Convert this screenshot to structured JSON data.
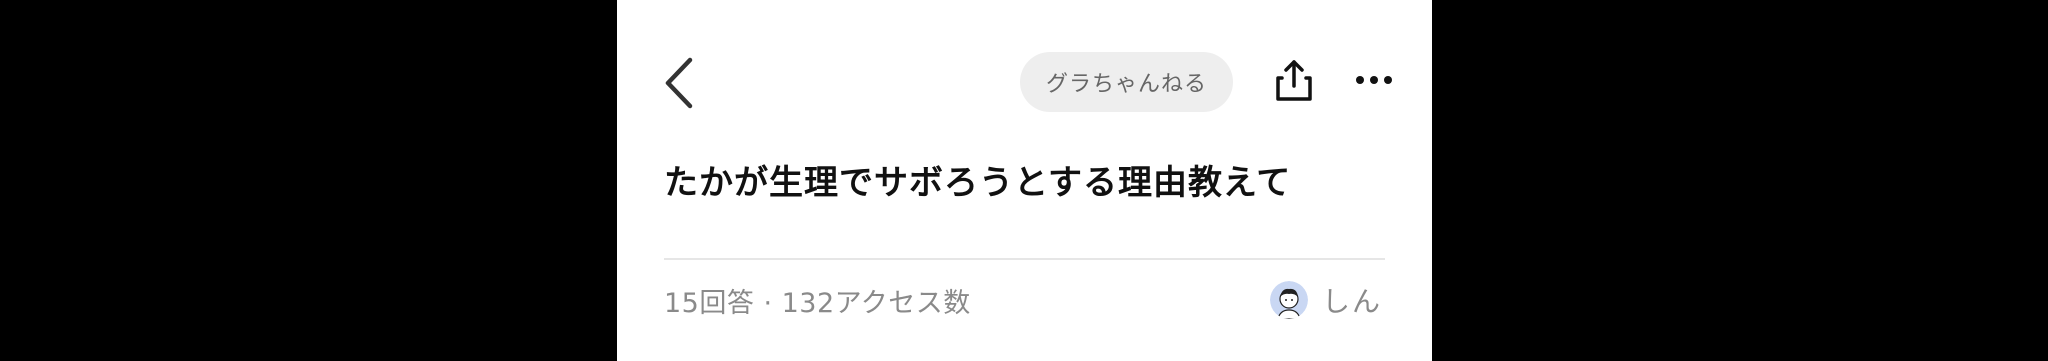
{
  "header": {
    "channel_label": "グラちゃんねる"
  },
  "question": {
    "title": "たかが生理でサボろうとする理由教えて",
    "meta": "15回答 · 132アクセス数",
    "author_name": "しん"
  },
  "colors": {
    "chip_background": "#eeeeee",
    "divider": "#e6e6e6",
    "meta_text": "#8a8a8a",
    "avatar_background": "#c9d7f3"
  },
  "icons": {
    "back": "chevron-left-icon",
    "share": "share-icon",
    "more": "ellipsis-icon"
  }
}
